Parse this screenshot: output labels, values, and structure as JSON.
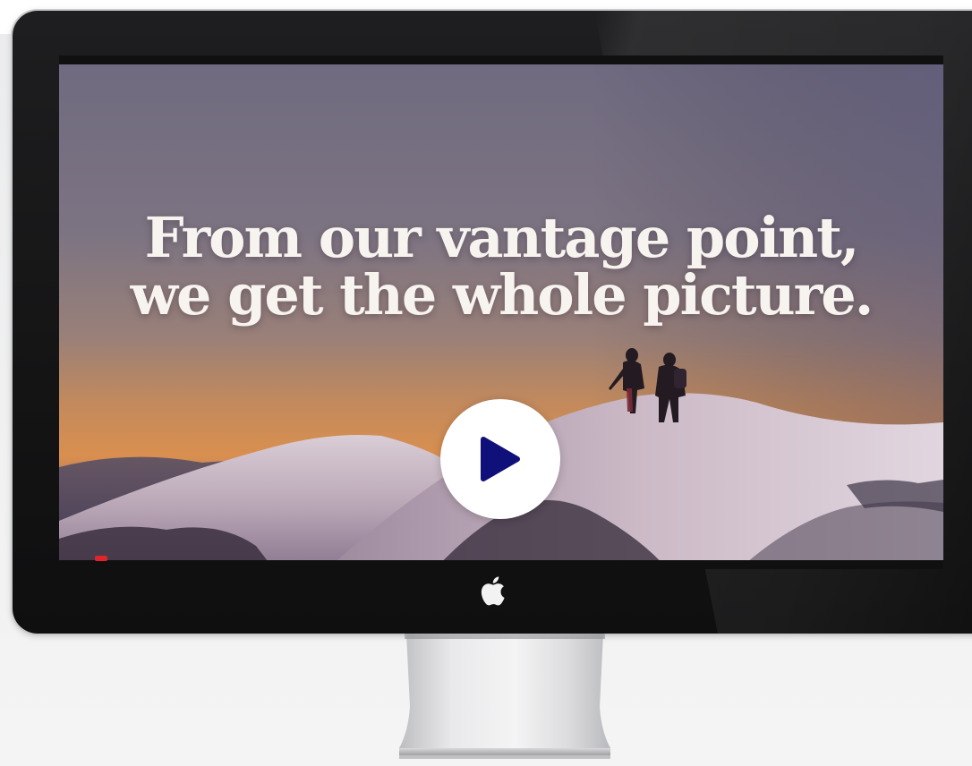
{
  "video": {
    "headline_line1": "From our vantage point,",
    "headline_line2": "we get the whole picture.",
    "play_icon": "play-icon",
    "play_color": "#10107a",
    "progress_color": "#e0242a"
  },
  "device": {
    "logo_icon": "apple-logo-icon"
  }
}
